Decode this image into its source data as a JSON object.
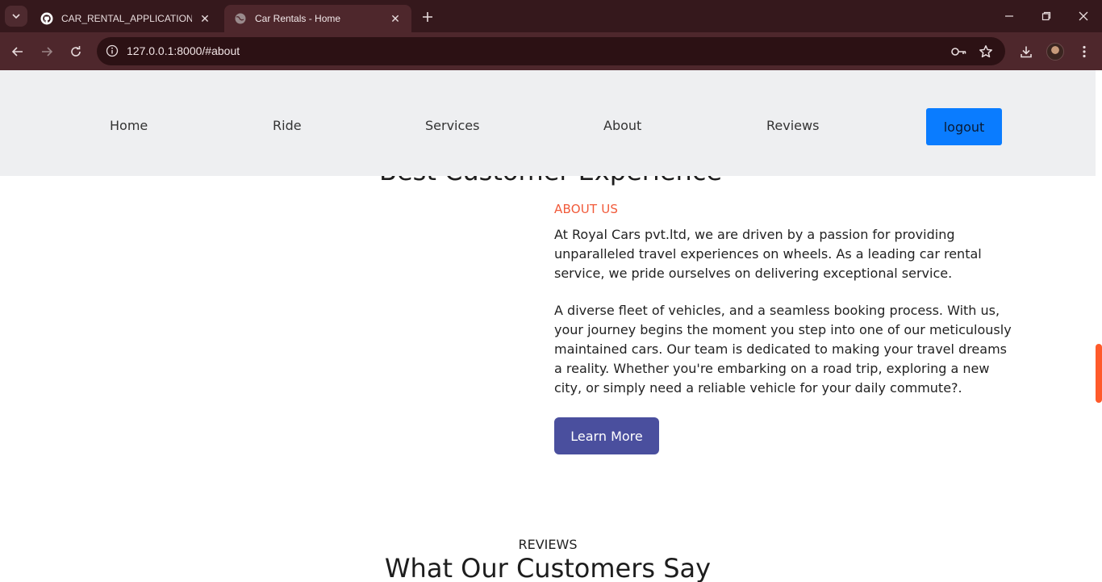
{
  "browser": {
    "tabs": [
      {
        "title": "CAR_RENTAL_APPLICATION/pp",
        "icon": "github-icon",
        "active": false
      },
      {
        "title": "Car Rentals - Home",
        "icon": "globe-icon",
        "active": true
      }
    ],
    "url": "127.0.0.1:8000/#about"
  },
  "nav": {
    "items": [
      "Home",
      "Ride",
      "Services",
      "About",
      "Reviews"
    ],
    "logout_label": "logout",
    "logout_color": "#0a7cff"
  },
  "about": {
    "clipped_heading": "Best Customer Experience",
    "eyebrow": "ABOUT US",
    "paragraph1": "At Royal Cars pvt.ltd, we are driven by a passion for providing unparalleled travel experiences on wheels. As a leading car rental service, we pride ourselves on delivering exceptional service.",
    "paragraph2": "A diverse fleet of vehicles, and a seamless booking process. With us, your journey begins the moment you step into one of our meticulously maintained cars. Our team is dedicated to making your travel dreams a reality. Whether you're embarking on a road trip, exploring a new city, or simply need a reliable vehicle for your daily commute?.",
    "learn_more_label": "Learn More",
    "accent_color": "#f15a3a",
    "button_color": "#4a4f9e"
  },
  "reviews": {
    "eyebrow": "REVIEWS",
    "title": "What Our Customers Say"
  }
}
